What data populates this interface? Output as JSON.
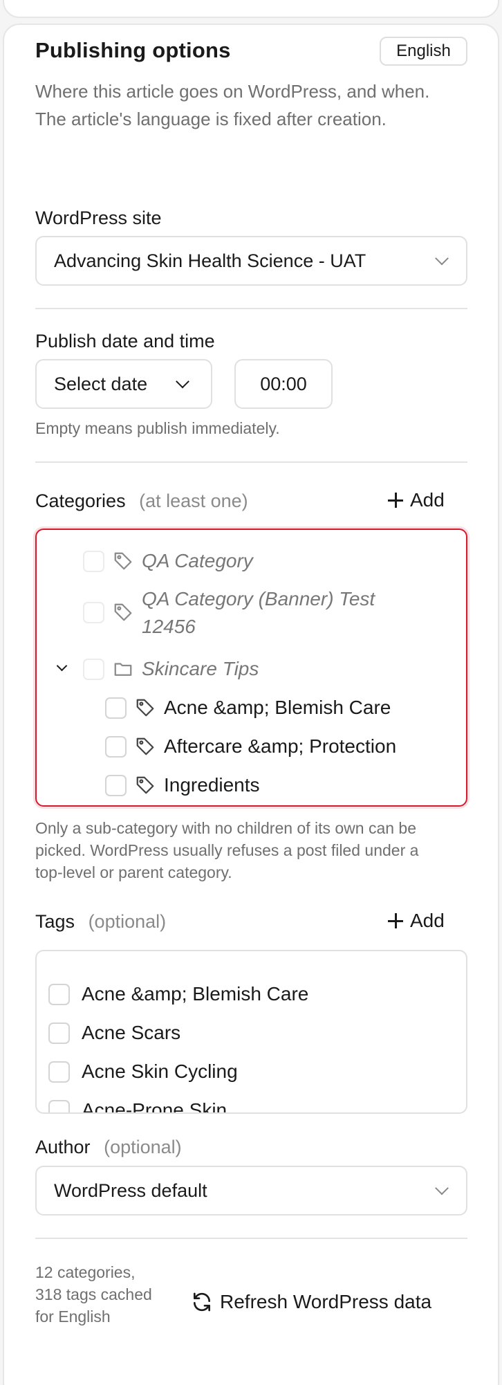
{
  "header": {
    "title": "Publishing options",
    "language_badge": "English",
    "description": "Where this article goes on WordPress, and when. The article's language is fixed after creation."
  },
  "site": {
    "label": "WordPress site",
    "selected": "Advancing Skin Health Science - UAT"
  },
  "schedule": {
    "label": "Publish date and time",
    "date_placeholder": "Select date",
    "time_value": "00:00",
    "hint": "Empty means publish immediately."
  },
  "categories": {
    "label": "Categories",
    "qualifier": "(at least one)",
    "add_label": "Add",
    "items": [
      {
        "label": "QA Category",
        "selectable": false
      },
      {
        "label": "QA Category (Banner) Test 12456",
        "selectable": false
      },
      {
        "label": "Skincare Tips",
        "selectable": false,
        "expanded": true
      },
      {
        "label": "Acne &amp; Blemish Care",
        "selectable": true
      },
      {
        "label": "Aftercare &amp; Protection",
        "selectable": true
      },
      {
        "label": "Ingredients",
        "selectable": true
      }
    ],
    "hint": "Only a sub-category with no children of its own can be picked. WordPress usually refuses a post filed under a top-level or parent category.",
    "error_border_color": "#d7192c"
  },
  "tags": {
    "label": "Tags",
    "qualifier": "(optional)",
    "add_label": "Add",
    "items": [
      "Acne &amp; Blemish Care",
      "Acne Scars",
      "Acne Skin Cycling",
      "Acne-Prone Skin"
    ]
  },
  "author": {
    "label": "Author",
    "qualifier": "(optional)",
    "selected": "WordPress default"
  },
  "footer": {
    "cache_status": "12 categories, 318 tags cached for English",
    "refresh_label": "Refresh WordPress data"
  }
}
